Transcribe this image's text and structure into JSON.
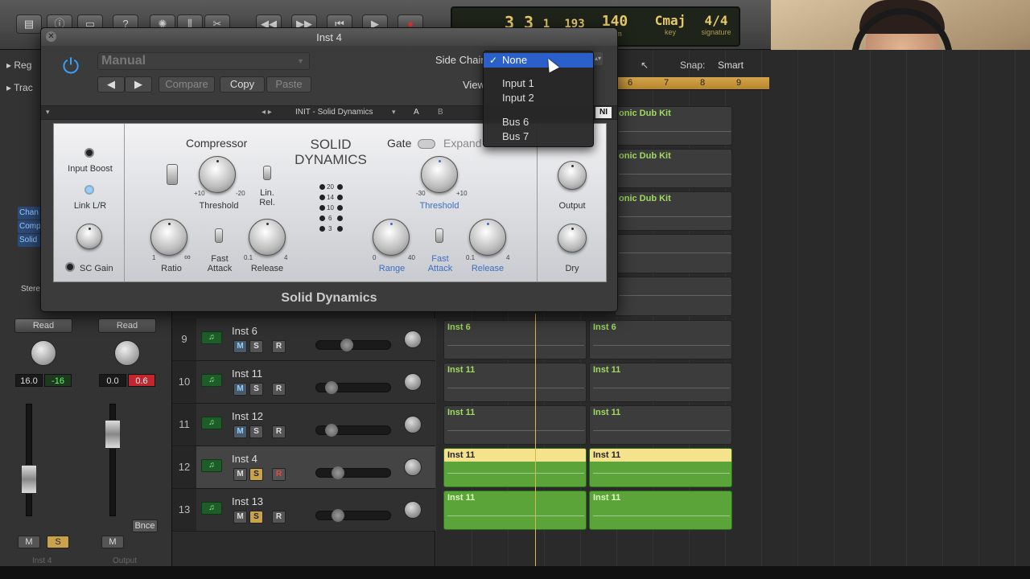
{
  "lcd": {
    "bar": "3",
    "beat": "3",
    "div": "1",
    "tick": "193",
    "tempo": "140",
    "tempo_label": "bpm",
    "key": "Cmaj",
    "key_label": "key",
    "signature": "4/4",
    "signature_label": "signature"
  },
  "snap": {
    "label": "Snap:",
    "value": "Smart"
  },
  "ruler": [
    "6",
    "7",
    "8",
    "9"
  ],
  "plugin": {
    "title": "Inst 4",
    "preset": "Manual",
    "compare": "Compare",
    "copy": "Copy",
    "paste": "Paste",
    "side_chain_label": "Side Chain:",
    "view_label": "View",
    "nav_preset": "INIT - Solid Dynamics",
    "ab_a": "A",
    "ab_b": "B",
    "ni": "NI",
    "footer": "Solid Dynamics",
    "panel": {
      "brand_line1": "SOLID",
      "brand_line2": "DYNAMICS",
      "input_boost": "Input Boost",
      "link": "Link L/R",
      "sc_gain": "SC Gain",
      "compressor": "Compressor",
      "threshold": "Threshold",
      "lin_rel_1": "Lin.",
      "lin_rel_2": "Rel.",
      "ratio": "Ratio",
      "fast_attack_1": "Fast",
      "fast_attack_2": "Attack",
      "release": "Release",
      "gate": "Gate",
      "expand": "Expand",
      "gate_threshold": "Threshold",
      "range": "Range",
      "gate_fast_1": "Fast",
      "gate_fast_2": "Attack",
      "gate_release": "Release",
      "output": "Output",
      "dry": "Dry",
      "th_min": "+10",
      "th_max": "-20",
      "ratio_min": "1",
      "ratio_max": "∞",
      "rel_min": "0.1",
      "rel_max": "4",
      "gth_min": "-30",
      "gth_max": "+10",
      "range_min": "0",
      "range_max": "40",
      "grel_min": "0.1",
      "grel_max": "4",
      "leds": [
        "20",
        "14",
        "10",
        "6",
        "3"
      ]
    }
  },
  "dropdown": {
    "items": [
      "None",
      "Input 1",
      "Input 2",
      "Bus 6",
      "Bus 7"
    ],
    "selected": "None",
    "check": "✓"
  },
  "tracks": [
    {
      "num": "9",
      "name": "Inst 6"
    },
    {
      "num": "10",
      "name": "Inst 11"
    },
    {
      "num": "11",
      "name": "Inst 12"
    },
    {
      "num": "12",
      "name": "Inst 4"
    },
    {
      "num": "13",
      "name": "Inst 13"
    }
  ],
  "track_buttons": {
    "m": "M",
    "s": "S",
    "r": "R"
  },
  "regions_top": [
    "onic Dub Kit",
    "onic Dub Kit",
    "onic Dub Kit"
  ],
  "regions": [
    [
      "Inst 6",
      "Inst 6"
    ],
    [
      "Inst 11",
      "Inst 11"
    ],
    [
      "Inst 11",
      "Inst 11"
    ],
    [
      "Inst 11",
      "Inst 11"
    ],
    [
      "Inst 11",
      "Inst 11"
    ]
  ],
  "inspector": {
    "read1": "Read",
    "read2": "Read",
    "val1a": "16.0",
    "val1b": "-16",
    "val2a": "0.0",
    "val2b": "0.6",
    "bnce": "Bnce",
    "m1": "M",
    "s1": "S",
    "m2": "M",
    "strip1": "Inst 4",
    "strip2": "Output",
    "reg": "Reg",
    "trac": "Trac",
    "side1": "Chan",
    "side2": "Comp",
    "side3": "Solid",
    "ster": "Stere"
  },
  "colors": {
    "accent": "#2b5fca",
    "region_green": "#5aa43a",
    "region_yellow": "#f4e28c",
    "lcd_text": "#e9c96a"
  }
}
